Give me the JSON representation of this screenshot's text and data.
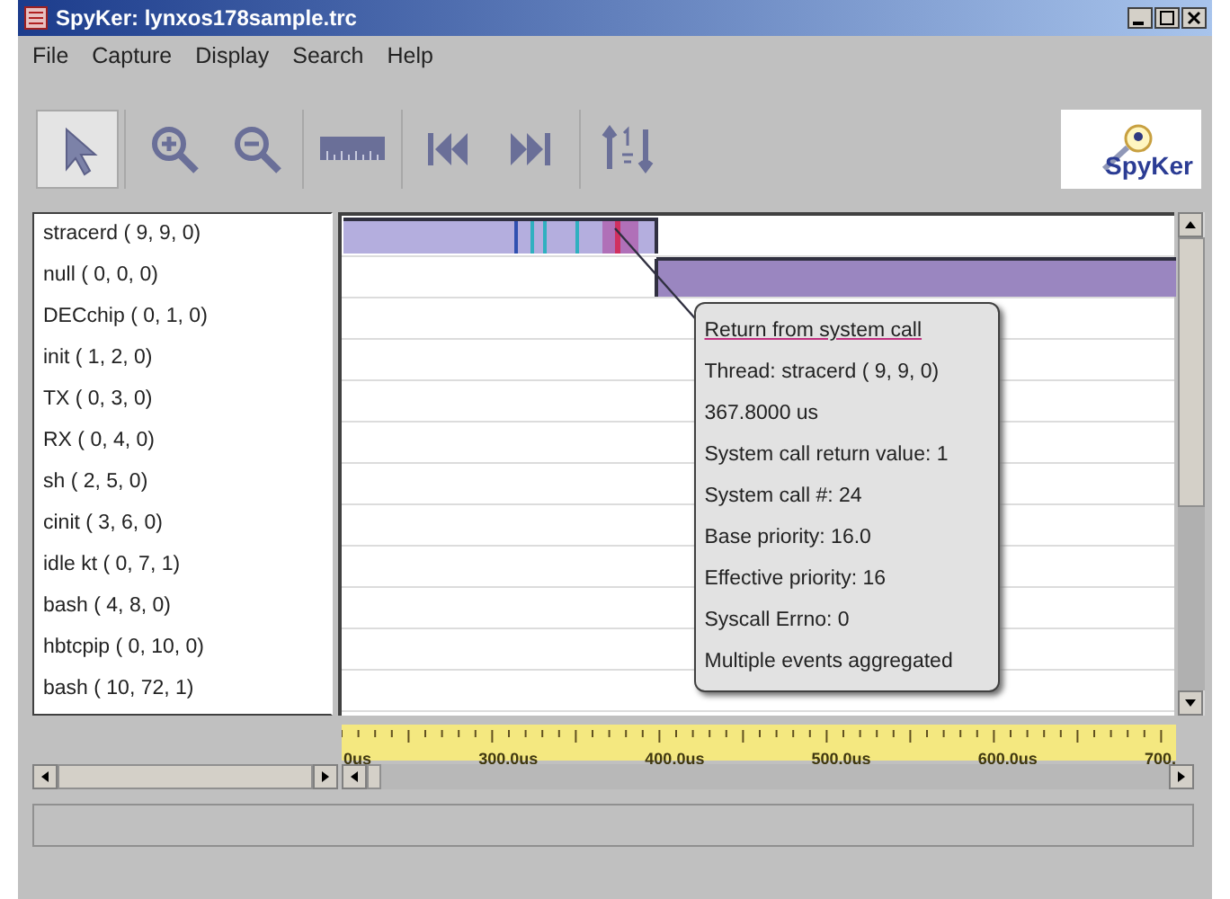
{
  "window": {
    "title": "SpyKer: lynxos178sample.trc"
  },
  "menu": [
    "File",
    "Capture",
    "Display",
    "Search",
    "Help"
  ],
  "toolbar": [
    {
      "kind": "pointer",
      "selected": true
    },
    {
      "kind": "zoom-in",
      "selected": false
    },
    {
      "kind": "zoom-out",
      "selected": false
    },
    {
      "kind": "ruler",
      "selected": false
    },
    {
      "kind": "first",
      "selected": false
    },
    {
      "kind": "last",
      "selected": false
    },
    {
      "kind": "sort",
      "selected": false
    }
  ],
  "logo": {
    "text": "SpyKer"
  },
  "threads": [
    "stracerd ( 9, 9, 0)",
    "null ( 0, 0, 0)",
    "DECchip ( 0, 1, 0)",
    "init ( 1, 2, 0)",
    "TX ( 0, 3, 0)",
    "RX ( 0, 4, 0)",
    "sh ( 2, 5, 0)",
    "cinit ( 3, 6, 0)",
    "idle kt ( 0, 7, 1)",
    "bash ( 4, 8, 0)",
    "hbtcpip ( 0, 10, 0)",
    "bash ( 10, 72, 1)"
  ],
  "tooltip": {
    "title": "Return from system call",
    "lines": [
      "Thread: stracerd ( 9, 9, 0)",
      "367.8000 us",
      "System call return value: 1",
      "System call #: 24",
      "Base priority: 16.0",
      "Effective priority: 16",
      "Syscall Errno: 0",
      "Multiple events aggregated"
    ]
  },
  "ruler": [
    "0us",
    "300.0us",
    "400.0us",
    "500.0us",
    "600.0us",
    "700."
  ]
}
